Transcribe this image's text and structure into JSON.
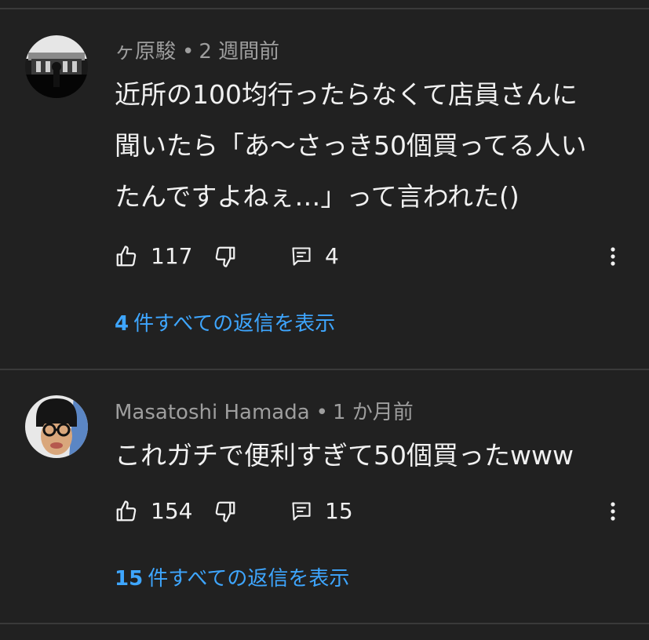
{
  "comments": [
    {
      "author": "ヶ原駿",
      "time": "2 週間前",
      "body_lines": [
        "近所の100均行ったらなくて店員さんに",
        "聞いたら「あ〜さっき50個買ってる人い",
        "たんですよねぇ…」って言われた()"
      ],
      "likes": "117",
      "replies": "4",
      "view_replies_count": "4",
      "view_replies_label": "件すべての返信を表示"
    },
    {
      "author": "Masatoshi Hamada",
      "time": "1 か月前",
      "body_lines": [
        "これガチで便利すぎて50個買ったwww"
      ],
      "likes": "154",
      "replies": "15",
      "view_replies_count": "15",
      "view_replies_label": "件すべての返信を表示"
    }
  ],
  "separator": "•",
  "icons": {
    "like": "thumbs-up-icon",
    "dislike": "thumbs-down-icon",
    "reply": "comment-icon",
    "more": "more-vertical-icon"
  },
  "colors": {
    "background": "#212121",
    "link": "#3ea6ff",
    "meta": "#9e9e9e"
  }
}
